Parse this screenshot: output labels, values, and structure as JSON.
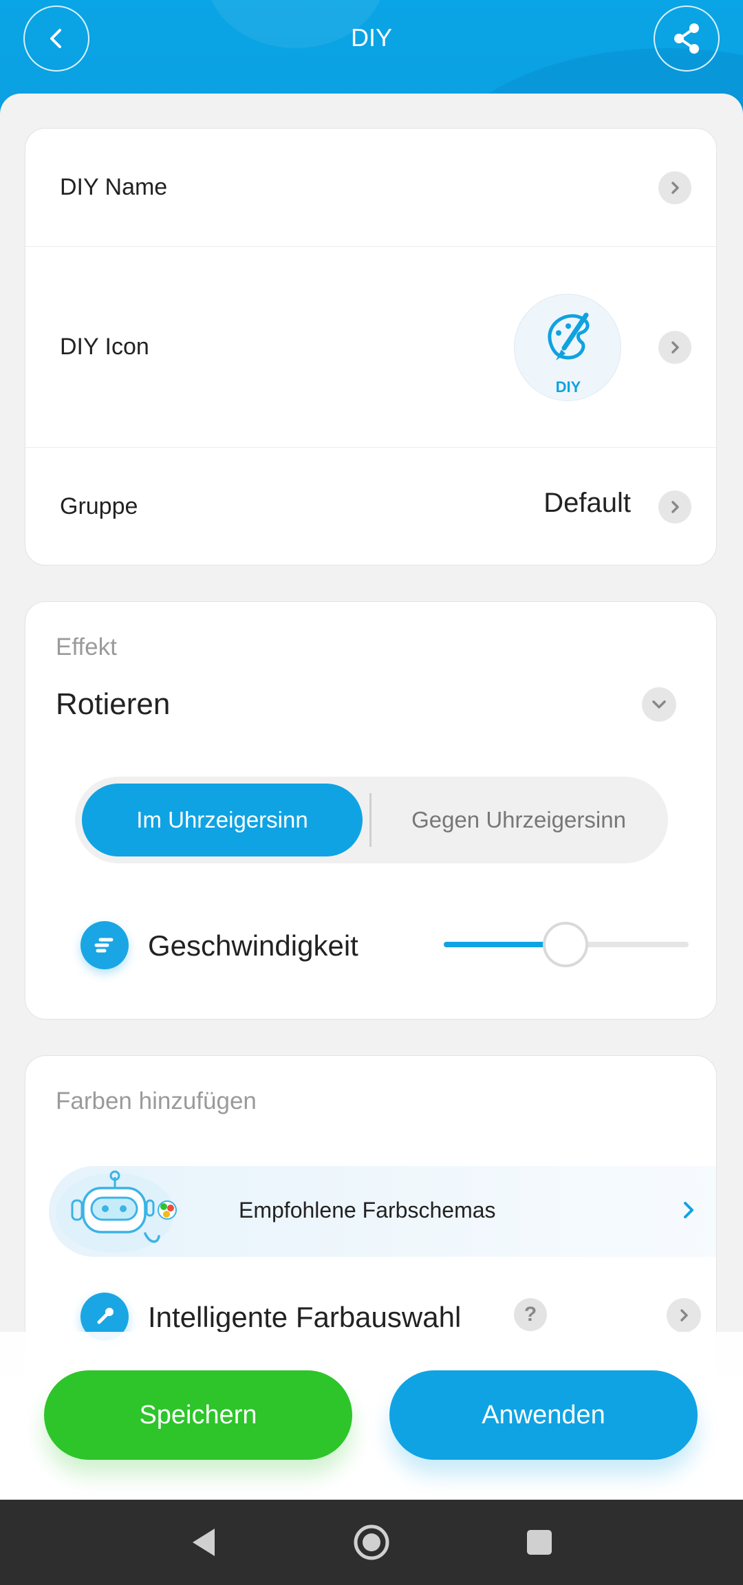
{
  "header": {
    "title": "DIY"
  },
  "settings": {
    "name_label": "DIY Name",
    "icon_label": "DIY Icon",
    "icon_badge_text": "DIY",
    "group_label": "Gruppe",
    "group_value": "Default"
  },
  "effect": {
    "section_label": "Effekt",
    "value": "Rotieren",
    "direction": {
      "options": [
        "Im Uhrzeigersinn",
        "Gegen Uhrzeigersinn"
      ],
      "selected": "Im Uhrzeigersinn"
    },
    "speed_label": "Geschwindigkeit",
    "speed_level": 0.48
  },
  "colors": {
    "section_label": "Farben hinzufügen",
    "recommended_label": "Empfohlene Farbschemas",
    "smart_label": "Intelligente Farbauswahl",
    "help_symbol": "?"
  },
  "actions": {
    "save_label": "Speichern",
    "apply_label": "Anwenden"
  },
  "theme": {
    "primary": "#0fa3e3",
    "save_green": "#2dc52a",
    "background": "#f2f2f2"
  }
}
